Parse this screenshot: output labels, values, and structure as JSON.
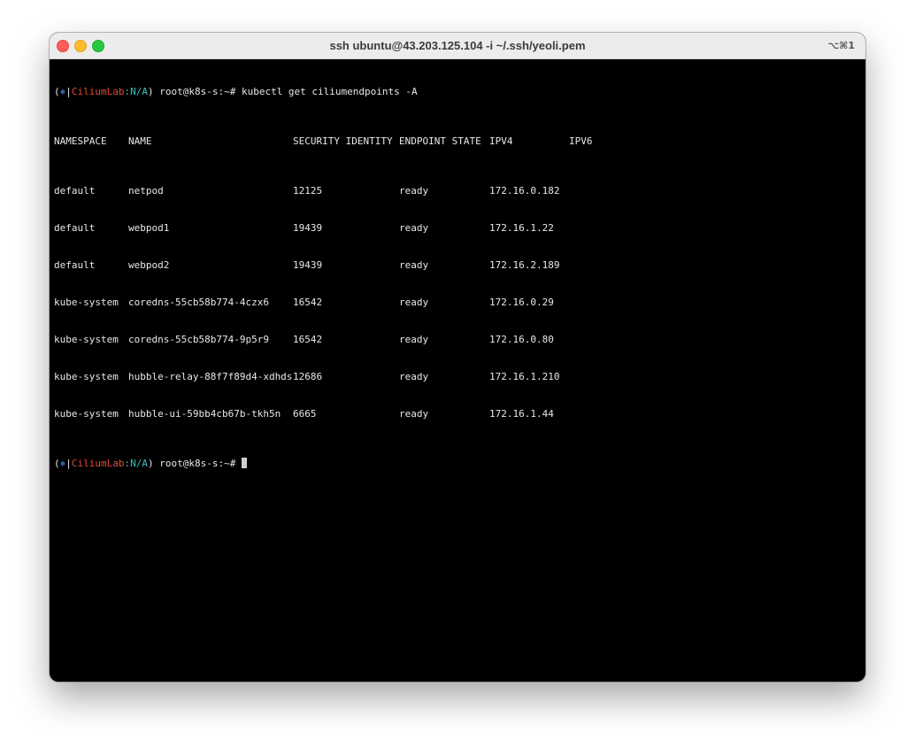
{
  "window": {
    "title": "ssh ubuntu@43.203.125.104 -i ~/.ssh/yeoli.pem",
    "shortcut": "⌥⌘1"
  },
  "prompt": {
    "open_paren": "(",
    "k8s_icon": "⎈",
    "separator": "|",
    "context": "CiliumLab",
    "colon": ":",
    "namespace": "N/A",
    "close_and_user": ") root@k8s-s:~# "
  },
  "command": "kubectl get ciliumendpoints -A",
  "table": {
    "headers": [
      "NAMESPACE",
      "NAME",
      "SECURITY IDENTITY",
      "ENDPOINT STATE",
      "IPV4",
      "IPV6"
    ],
    "rows": [
      [
        "default",
        "netpod",
        "12125",
        "ready",
        "172.16.0.182",
        ""
      ],
      [
        "default",
        "webpod1",
        "19439",
        "ready",
        "172.16.1.22",
        ""
      ],
      [
        "default",
        "webpod2",
        "19439",
        "ready",
        "172.16.2.189",
        ""
      ],
      [
        "kube-system",
        "coredns-55cb58b774-4czx6",
        "16542",
        "ready",
        "172.16.0.29",
        ""
      ],
      [
        "kube-system",
        "coredns-55cb58b774-9p5r9",
        "16542",
        "ready",
        "172.16.0.80",
        ""
      ],
      [
        "kube-system",
        "hubble-relay-88f7f89d4-xdhds",
        "12686",
        "ready",
        "172.16.1.210",
        ""
      ],
      [
        "kube-system",
        "hubble-ui-59bb4cb67b-tkh5n",
        "6665",
        "ready",
        "172.16.1.44",
        ""
      ]
    ]
  }
}
